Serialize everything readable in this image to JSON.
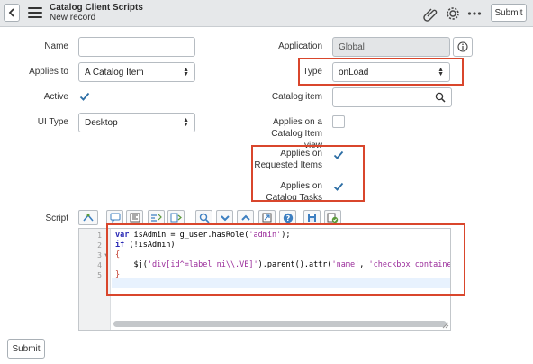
{
  "header": {
    "title": "Catalog Client Scripts",
    "subtitle": "New record",
    "submit_label": "Submit"
  },
  "form": {
    "name": {
      "label": "Name",
      "value": ""
    },
    "applies_to": {
      "label": "Applies to",
      "value": "A Catalog Item"
    },
    "active": {
      "label": "Active",
      "checked": true
    },
    "ui_type": {
      "label": "UI Type",
      "value": "Desktop"
    },
    "application": {
      "label": "Application",
      "value": "Global"
    },
    "type": {
      "label": "Type",
      "value": "onLoad"
    },
    "catalog_item": {
      "label": "Catalog item",
      "value": ""
    },
    "applies_on_catalog_item_view": {
      "label": "Applies on a Catalog Item view",
      "checked": false
    },
    "applies_on_requested_items": {
      "label": "Applies on Requested Items",
      "checked": true
    },
    "applies_on_catalog_tasks": {
      "label": "Applies on Catalog Tasks",
      "checked": true
    },
    "script": {
      "label": "Script"
    }
  },
  "toolbar_icons": [
    "script-include-icon",
    "comment-icon",
    "format-icon",
    "replace-icon",
    "replace-all-icon",
    "search-icon",
    "collapse-icon",
    "expand-icon",
    "fullscreen-icon",
    "help-icon",
    "save-icon",
    "syntax-check-icon"
  ],
  "editor": {
    "line_numbers": [
      "1",
      "2",
      "3",
      "4",
      "5"
    ],
    "lines": [
      {
        "kw": "var",
        "rest": " isAdmin = g_user.hasRole(",
        "str": "'admin'",
        "tail": ");"
      },
      {
        "kw": "if",
        "rest": " (!isAdmin)",
        "str": "",
        "tail": ""
      },
      {
        "kw": "",
        "rest": "",
        "str": "",
        "tail": "{"
      },
      {
        "kw": "",
        "rest": "    $j(",
        "str": "'div[id^=label_ni\\\\.VE]'",
        "tail": ").parent().attr("
      },
      {
        "kw": "",
        "rest": "",
        "str": "",
        "tail": "}"
      }
    ],
    "line4_more": {
      "str1": "'name'",
      "sep": ", ",
      "str2": "'checkbox_containe"
    }
  },
  "footer": {
    "submit_label": "Submit"
  },
  "colors": {
    "highlight": "#d9462c",
    "header_bg": "#e6e8ea",
    "checkbox": "#2d6ea5"
  }
}
